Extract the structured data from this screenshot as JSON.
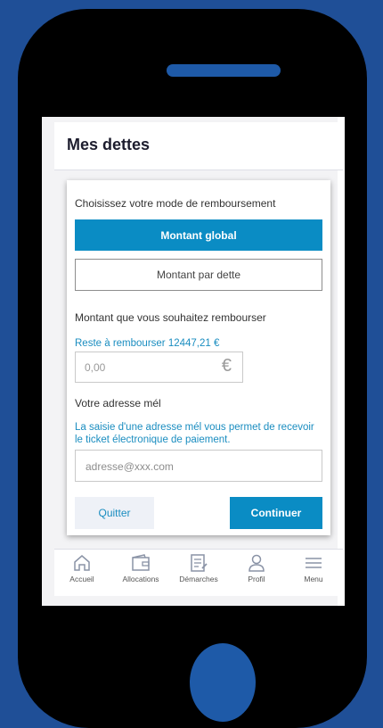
{
  "app": {
    "title": "Mes dettes"
  },
  "modal": {
    "mode_label": "Choisissez votre mode de remboursement",
    "option_global": "Montant global",
    "option_par_dette": "Montant par dette",
    "amount_label": "Montant que vous souhaitez rembourser",
    "remaining_text": "Reste à rembourser 12447,21 €",
    "amount_value": "0,00",
    "currency_symbol": "€",
    "email_label": "Votre adresse mél",
    "email_info": "La saisie d'une adresse mél vous permet de recevoir le ticket électronique de paiement.",
    "email_placeholder": "adresse@xxx.com",
    "quit_label": "Quitter",
    "continue_label": "Continuer"
  },
  "nav": {
    "items": [
      {
        "label": "Accueil",
        "icon": "home-icon"
      },
      {
        "label": "Allocations",
        "icon": "wallet-icon"
      },
      {
        "label": "Démarches",
        "icon": "document-edit-icon"
      },
      {
        "label": "Profil",
        "icon": "user-icon"
      },
      {
        "label": "Menu",
        "icon": "menu-icon"
      }
    ]
  },
  "colors": {
    "background": "#1f4f97",
    "accent": "#0a8cc4",
    "link": "#1a8dc0"
  }
}
